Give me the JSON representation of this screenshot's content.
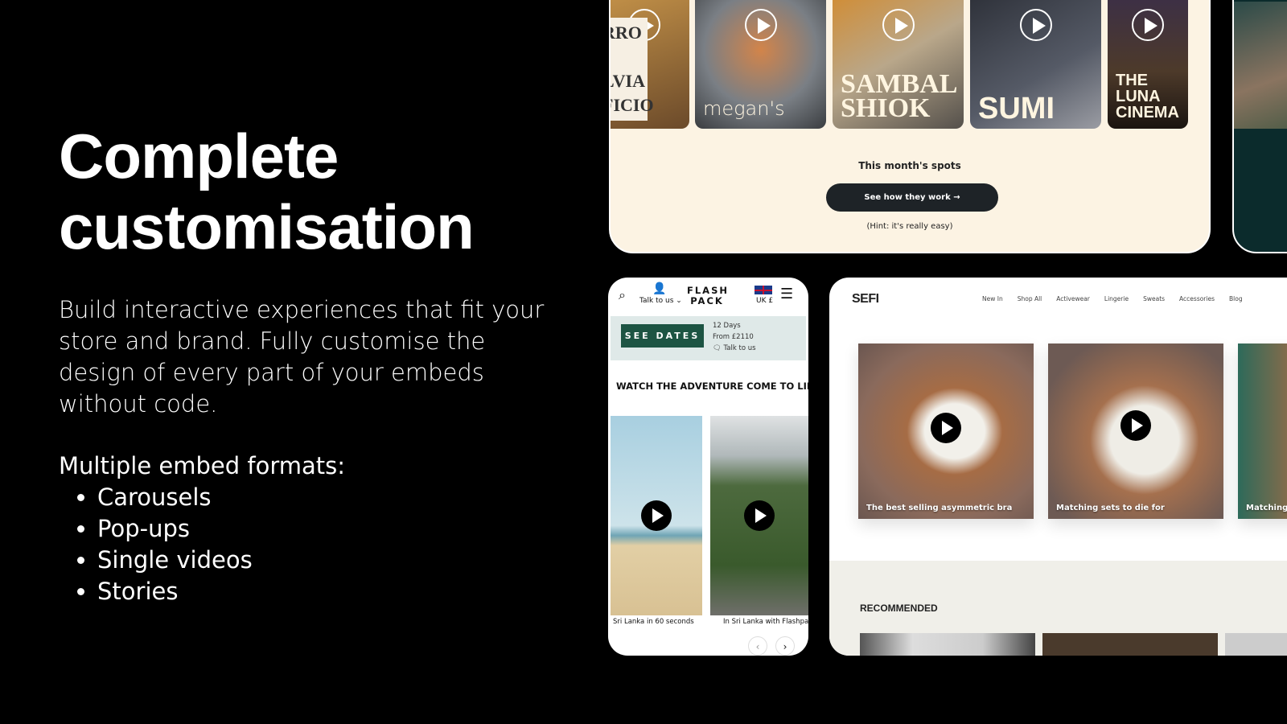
{
  "headline": "Complete customisation",
  "description": "Build interactive experiences that fit your store and brand. Fully customise the design of every part of your embeds without code.",
  "formats": {
    "title": "Multiple embed formats:",
    "items": [
      "Carousels",
      "Pop-ups",
      "Single videos",
      "Stories"
    ]
  },
  "stories_embed": {
    "tiles": [
      {
        "label": "RRO e LVIA FICIO"
      },
      {
        "label": "megan's"
      },
      {
        "label": "SAMBAL SHIOK"
      },
      {
        "label": "SUMI"
      },
      {
        "label": "THE LUNA CINEMA"
      }
    ],
    "title": "This month's spots",
    "cta": "See how they work →",
    "hint": "(Hint: it's really easy)"
  },
  "flashpack": {
    "logo": "FLASH PACK",
    "talk": "Talk to us ⌄",
    "locale": "UK £",
    "see_dates": "SEE DATES",
    "days": "12 Days",
    "price": "From £2110",
    "talk2": "Talk to us",
    "heading": "WATCH THE ADVENTURE COME TO LIFE",
    "videos": [
      {
        "caption": "Sri Lanka in 60 seconds"
      },
      {
        "caption": "In Sri Lanka with Flashpack Suganthi"
      }
    ]
  },
  "sefi": {
    "logo": "SEFI",
    "nav": [
      "New In",
      "Shop All",
      "Activewear",
      "Lingerie",
      "Sweats",
      "Accessories",
      "Blog"
    ],
    "products": [
      {
        "caption": "The best selling asymmetric bra"
      },
      {
        "caption": "Matching sets to die for"
      },
      {
        "caption": "Matching"
      }
    ],
    "recommended": "RECOMMENDED"
  }
}
